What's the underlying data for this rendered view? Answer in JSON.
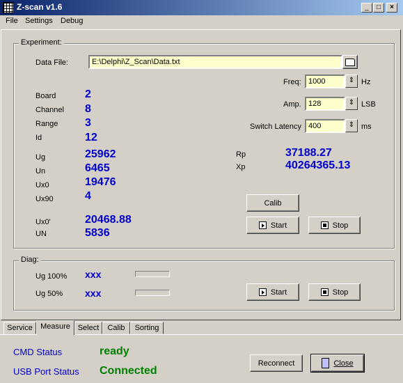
{
  "window": {
    "title": "Z-scan v1.6",
    "controls": {
      "minimize": "_",
      "maximize": "□",
      "close": "×"
    }
  },
  "menu": [
    "File",
    "Settings",
    "Debug"
  ],
  "experiment": {
    "title": "Experiment:",
    "data_file_label": "Data File:",
    "data_file_value": "E:\\Delphi\\Z_Scan\\Data.txt",
    "labels": {
      "board": "Board",
      "channel": "Channel",
      "range": "Range",
      "id": "Id",
      "ug": "Ug",
      "un": "Un",
      "ux0": "Ux0",
      "ux90": "Ux90",
      "ux0p": "Ux0'",
      "un_cap": "UN",
      "rp": "Rp",
      "xp": "Xp"
    },
    "values": {
      "board": "2",
      "channel": "8",
      "range": "3",
      "id": "12",
      "ug": "25962",
      "un": "6465",
      "ux0": "19476",
      "ux90": "4",
      "ux0p": "20468.88",
      "un_cap": "5836",
      "rp": "37188.27",
      "xp": "40264365.13"
    },
    "freq": {
      "label": "Freq:",
      "value": "1000",
      "unit": "Hz"
    },
    "amp": {
      "label": "Amp.",
      "value": "128",
      "unit": "LSB"
    },
    "latency": {
      "label": "Switch Latency",
      "value": "400",
      "unit": "ms"
    },
    "calib_button": "Calib",
    "start_button": "Start",
    "stop_button": "Stop"
  },
  "diag": {
    "title": "Diag:",
    "ug100_label": "Ug 100%",
    "ug100_value": "xxx",
    "ug50_label": "Ug 50%",
    "ug50_value": "xxx",
    "start_button": "Start",
    "stop_button": "Stop"
  },
  "tabs": [
    {
      "label": "Service",
      "active": false
    },
    {
      "label": "Measure",
      "active": true
    },
    {
      "label": "Select",
      "active": false
    },
    {
      "label": "Calib",
      "active": false
    },
    {
      "label": "Sorting",
      "active": false
    }
  ],
  "status": {
    "cmd_label": "CMD Status",
    "cmd_value": "ready",
    "usb_label": "USB Port Status",
    "usb_value": "Connected"
  },
  "buttons": {
    "reconnect": "Reconnect",
    "close": "Close"
  },
  "colors": {
    "titlebar_start": "#0a246a",
    "titlebar_end": "#a6caf0",
    "value_blue": "#0000cc",
    "status_green": "#008000",
    "field_yellow": "#ffffcc"
  }
}
